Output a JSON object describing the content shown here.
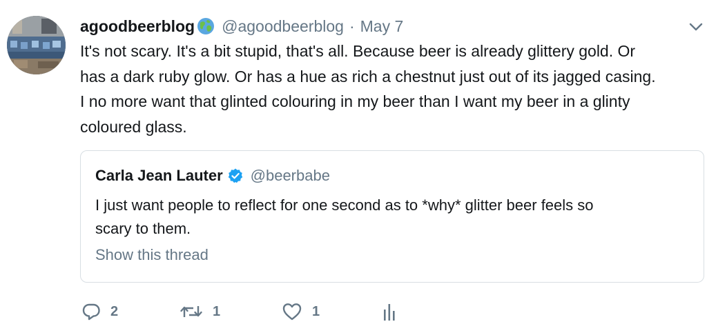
{
  "tweet": {
    "display_name": "agoodbeerblog",
    "handle": "@agoodbeerblog",
    "separator": "·",
    "date": "May 7",
    "name_emoji_icon": "globe-icon",
    "text_lines": [
      "It's not scary. It's a bit stupid, that's all. Because beer is already glittery gold. Or",
      "has a dark ruby glow. Or has a hue as rich a chestnut just out of its jagged casing.",
      "I no more want that glinted colouring in my beer than I want my beer in a glinty",
      "coloured glass."
    ]
  },
  "quoted_tweet": {
    "display_name": "Carla Jean Lauter",
    "verified_icon": "verified-badge-icon",
    "handle": "@beerbabe",
    "text_lines": [
      "I just want people to reflect for one second as to *why* glitter beer feels so",
      "scary to them."
    ],
    "show_thread_label": "Show this thread"
  },
  "actions": {
    "reply_count": "2",
    "retweet_count": "1",
    "like_count": "1",
    "icons": [
      "reply-icon",
      "retweet-icon",
      "like-icon",
      "analytics-icon"
    ]
  },
  "colors": {
    "primary_text": "#14171a",
    "secondary_text": "#657786",
    "verified_blue": "#1da1f2",
    "border": "#d8dee3"
  }
}
